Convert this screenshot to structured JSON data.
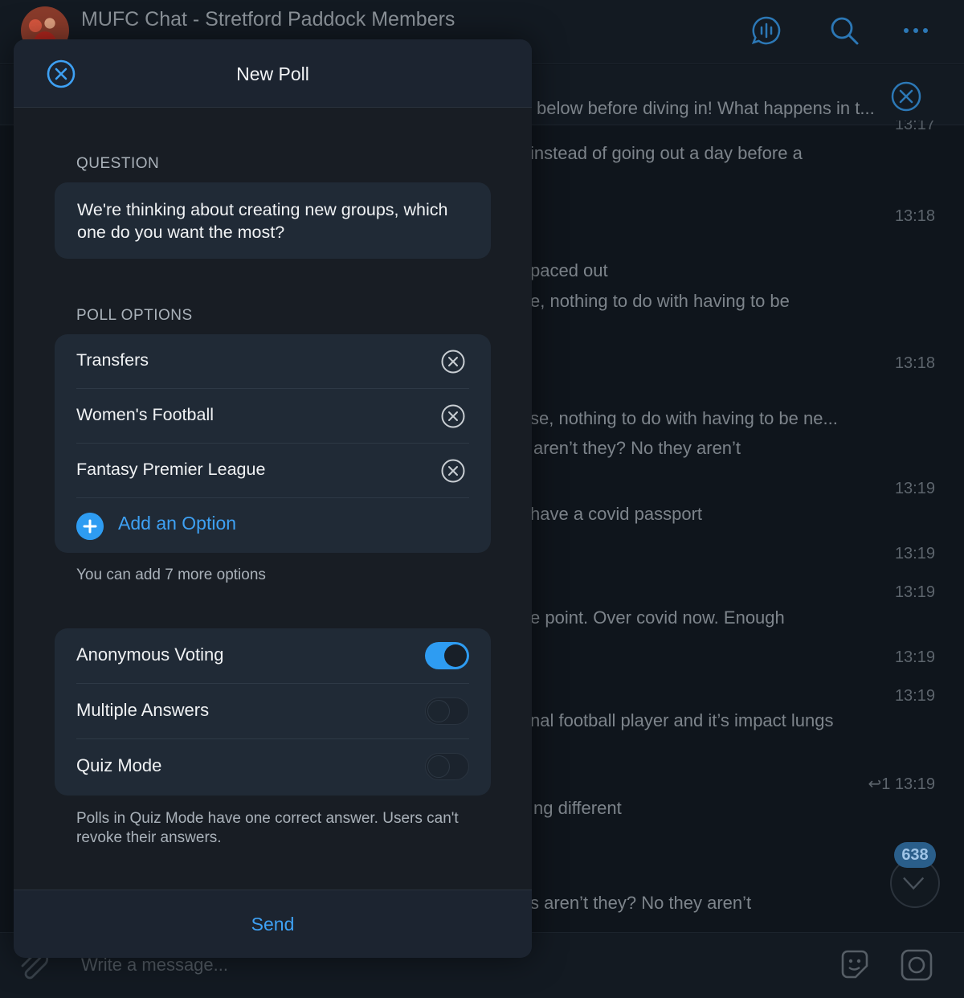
{
  "chat": {
    "title": "MUFC Chat - Stretford Paddock Members",
    "subtitle": "",
    "composer_placeholder": "Write a message...",
    "pinned_text": "below before diving in!  What happens in t...",
    "unread_count": "638",
    "messages": [
      {
        "text": "instead of going out a day before a",
        "time": "13:17"
      },
      {
        "text": "",
        "time": "13:18"
      },
      {
        "text": "paced out",
        "time": ""
      },
      {
        "text": "e, nothing to do with having to be",
        "time": "13:18"
      },
      {
        "text": "se, nothing to do with having to be ne...",
        "time": ""
      },
      {
        "text": "aren’t they? No they aren’t",
        "time": "13:19"
      },
      {
        "text": "have a covid passport",
        "time": "13:19"
      },
      {
        "text": "",
        "time": "13:19"
      },
      {
        "text": "e point. Over covid now. Enough",
        "time": "13:19"
      },
      {
        "text": "",
        "time": "13:19"
      },
      {
        "text": "nal football player and it’s impact lungs",
        "time": ""
      },
      {
        "text": "ng different",
        "time": ""
      },
      {
        "text": "s aren’t they? No they aren’t",
        "time": ""
      }
    ],
    "reply": {
      "count": "1",
      "time": "13:19"
    }
  },
  "modal": {
    "title": "New Poll",
    "question_label": "QUESTION",
    "question": "We're thinking about creating new groups, which one do you want the most?",
    "options_label": "POLL OPTIONS",
    "options": [
      "Transfers",
      "Women's Football",
      "Fantasy Premier League"
    ],
    "add_option_label": "Add an Option",
    "options_hint": "You can add 7 more options",
    "settings": [
      {
        "label": "Anonymous Voting",
        "enabled": true
      },
      {
        "label": "Multiple Answers",
        "enabled": false
      },
      {
        "label": "Quiz Mode",
        "enabled": false
      }
    ],
    "quiz_hint": "Polls in Quiz Mode have one correct answer. Users can't revoke their answers.",
    "send_label": "Send"
  },
  "colors": {
    "accent": "#2e9cf2",
    "modal_bg": "#181d24",
    "card_bg": "#202a36"
  }
}
